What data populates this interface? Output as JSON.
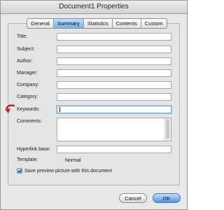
{
  "window": {
    "title": "Document1 Properties"
  },
  "tabs": [
    {
      "label": "General",
      "active": false
    },
    {
      "label": "Summary",
      "active": true
    },
    {
      "label": "Statistics",
      "active": false
    },
    {
      "label": "Contents",
      "active": false
    },
    {
      "label": "Custom",
      "active": false
    }
  ],
  "fields": {
    "title": {
      "label": "Title:",
      "value": ""
    },
    "subject": {
      "label": "Subject:",
      "value": ""
    },
    "author": {
      "label": "Author:",
      "value": ""
    },
    "manager": {
      "label": "Manager:",
      "value": ""
    },
    "company": {
      "label": "Company:",
      "value": ""
    },
    "category": {
      "label": "Category:",
      "value": ""
    },
    "keywords": {
      "label": "Keywords:",
      "value": ""
    },
    "comments": {
      "label": "Comments:",
      "value": ""
    },
    "hyperlink_base": {
      "label": "Hyperlink base:",
      "value": ""
    }
  },
  "template": {
    "label": "Template:",
    "value": "Normal"
  },
  "save_preview": {
    "label": "Save preview picture with this document",
    "checked": true
  },
  "buttons": {
    "cancel": "Cancel",
    "ok": "OK"
  },
  "colors": {
    "accent": "#4d95e3",
    "pointer_arrow": "#b0302a"
  },
  "icons": {
    "pointer": "curved-arrow-icon",
    "checkbox": "checkmark-icon"
  }
}
